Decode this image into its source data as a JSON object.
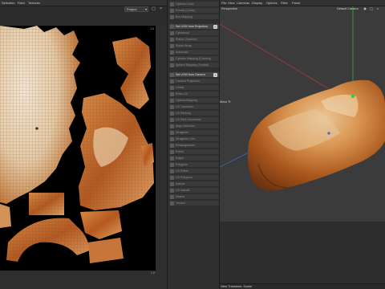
{
  "menubar": {
    "left_items": [
      "Selection",
      "Field",
      "Textures"
    ],
    "right_items": [
      "File",
      "View",
      "Cameras",
      "Display",
      "Options",
      "Filter",
      "Panel"
    ]
  },
  "uv_editor": {
    "dropdown_value": "Project",
    "corner_top_right": "1.0",
    "corner_bottom_right": "1.0",
    "colors": {
      "canvas": "#000000",
      "crust": "#c06a28",
      "crumb": "#ead9c2"
    }
  },
  "side_panel": {
    "rows": [
      {
        "label": "Optimal Cubic",
        "kind": "item"
      },
      {
        "label": "Frontal (Cubic)",
        "kind": "item"
      },
      {
        "label": "Box Mapping",
        "kind": "item"
      },
      {
        "label": "Set UVW from Projection",
        "kind": "head"
      },
      {
        "label": "Cylindrical",
        "kind": "item"
      },
      {
        "label": "Planar (Camera)",
        "kind": "item"
      },
      {
        "label": "Shrink Wrap",
        "kind": "item"
      },
      {
        "label": "Automatic",
        "kind": "item"
      },
      {
        "label": "Cylinder Mapping (Camera)",
        "kind": "item"
      },
      {
        "label": "Sphere Mapping (Frontal)",
        "kind": "item"
      },
      {
        "label": "Set UVW from Camera",
        "kind": "head"
      },
      {
        "label": "Camera Projection",
        "kind": "item"
      },
      {
        "label": "Unfold",
        "kind": "item"
      },
      {
        "label": "Relax UV",
        "kind": "item"
      },
      {
        "label": "Optimal Mapping",
        "kind": "item"
      },
      {
        "label": "UV Transform",
        "kind": "item"
      },
      {
        "label": "UV Packing",
        "kind": "item"
      },
      {
        "label": "UV Pack Geometric",
        "kind": "item"
      },
      {
        "label": "Align Selection",
        "kind": "item"
      },
      {
        "label": "Straighten",
        "kind": "item"
      },
      {
        "label": "Straighten UVs",
        "kind": "item"
      },
      {
        "label": "Rectangularize",
        "kind": "item"
      },
      {
        "label": "Points",
        "kind": "item"
      },
      {
        "label": "Edges",
        "kind": "item"
      },
      {
        "label": "Polygons",
        "kind": "item"
      },
      {
        "label": "UV Points",
        "kind": "item"
      },
      {
        "label": "UV Polygons",
        "kind": "item"
      },
      {
        "label": "Islands",
        "kind": "item"
      },
      {
        "label": "UV Islands",
        "kind": "item"
      },
      {
        "label": "Seams",
        "kind": "item"
      },
      {
        "label": "Terrace",
        "kind": "item"
      }
    ]
  },
  "viewport": {
    "label_perspective": "Perspective",
    "label_camera": "Default Camera",
    "label_move": "Move ↻",
    "status_text": "View Transform: Scene",
    "colors": {
      "background": "#3b3b3b",
      "floor": "#2d2d2d",
      "axis_x": "#c23c3c",
      "axis_y": "#3cc23c",
      "axis_z": "#3c6ec2"
    }
  }
}
